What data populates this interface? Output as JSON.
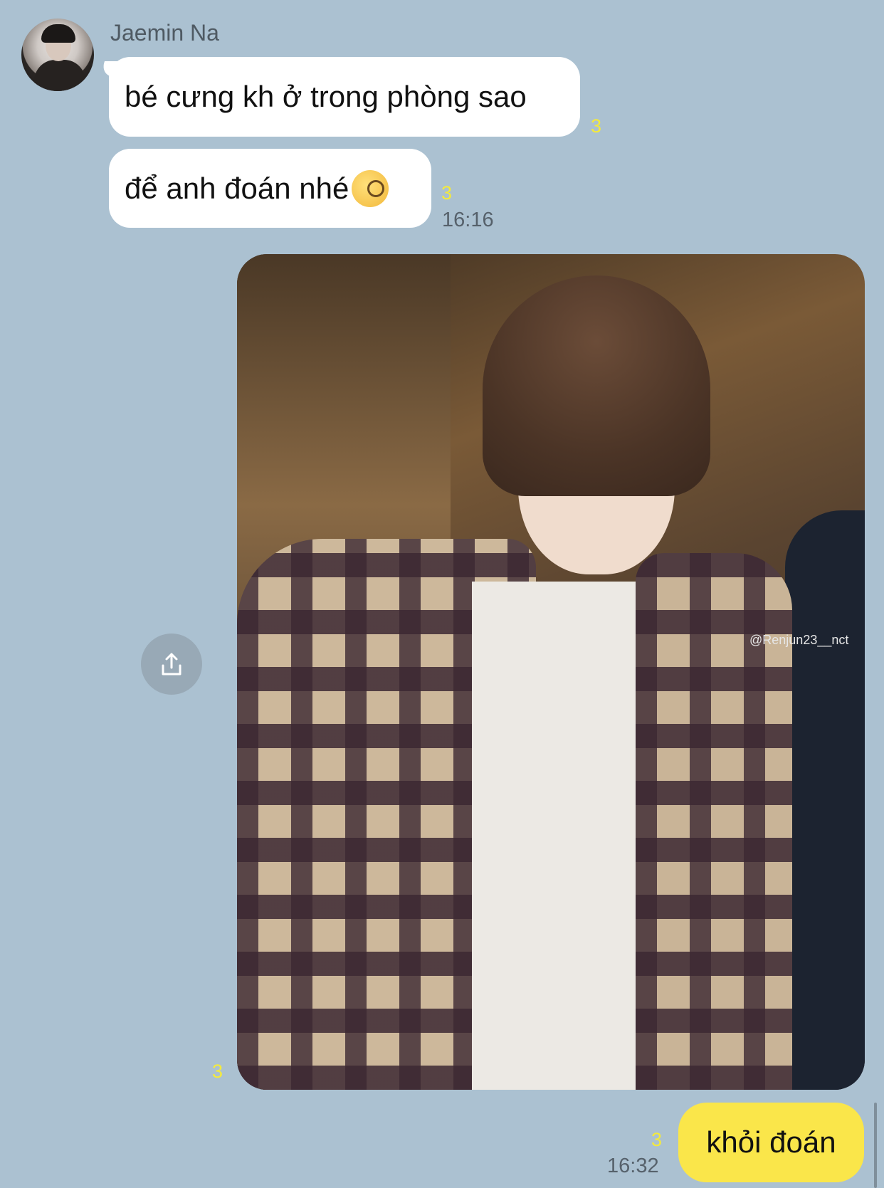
{
  "chat": {
    "sender_name": "Jaemin Na",
    "messages_in": [
      {
        "text": "bé cưng kh ở trong phòng sao",
        "unread": "3"
      },
      {
        "text": "để anh đoán nhé",
        "emoji": "monocle-face-emoji",
        "unread": "3",
        "time": "16:16"
      }
    ],
    "photo": {
      "watermark": "@Renjun23__nct",
      "unread": "3"
    },
    "message_out": {
      "text": "khỏi đoán",
      "unread": "3",
      "time": "16:32"
    }
  },
  "icons": {
    "share": "share-icon"
  },
  "colors": {
    "background": "#abc1d1",
    "incoming_bubble": "#ffffff",
    "outgoing_bubble": "#fae64a",
    "unread_count": "#f4ea3c"
  }
}
